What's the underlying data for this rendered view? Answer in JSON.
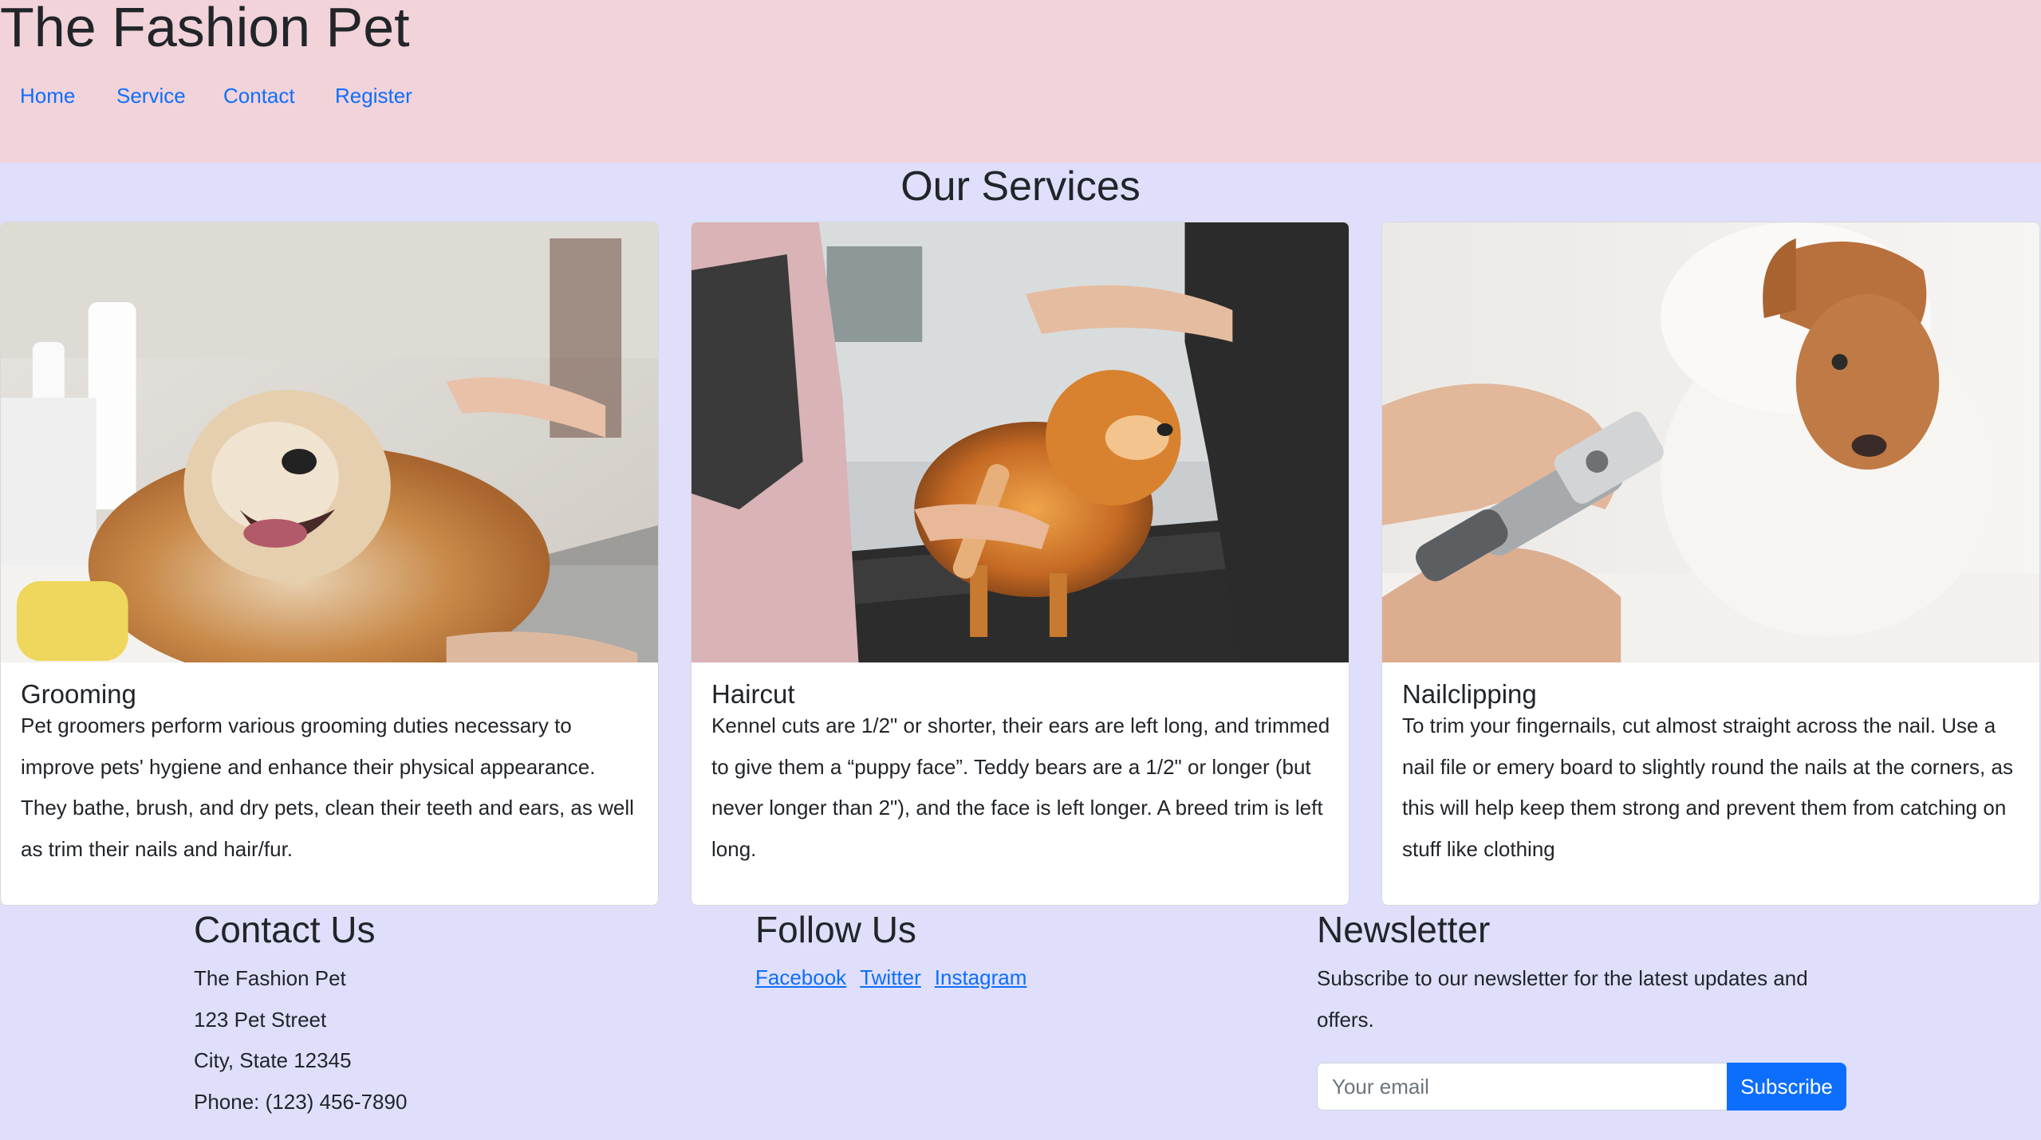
{
  "header": {
    "title": "The Fashion Pet",
    "nav": [
      {
        "label": "Home"
      },
      {
        "label": "Service"
      },
      {
        "label": "Contact"
      },
      {
        "label": "Register"
      }
    ]
  },
  "services": {
    "title": "Our Services",
    "cards": [
      {
        "title": "Grooming",
        "image": "dog-being-bathed-photo",
        "text": "Pet groomers perform various grooming duties necessary to improve pets' hygiene and enhance their physical appearance. They bathe, brush, and dry pets, clean their teeth and ears, as well as trim their nails and hair/fur."
      },
      {
        "title": "Haircut",
        "image": "pomeranian-haircut-photo",
        "text": "Kennel cuts are 1/2\" or shorter, their ears are left long, and trimmed to give them a “puppy face”. Teddy bears are a 1/2\" or longer (but never longer than 2\"), and the face is left longer. A breed trim is left long."
      },
      {
        "title": "Nailclipping",
        "image": "puppy-nail-clipping-photo",
        "text": "To trim your fingernails, cut almost straight across the nail. Use a nail file or emery board to slightly round the nails at the corners, as this will help keep them strong and prevent them from catching on stuff like clothing"
      }
    ]
  },
  "footer": {
    "contact": {
      "title": "Contact Us",
      "lines": [
        "The Fashion Pet",
        "123 Pet Street",
        "City, State 12345",
        "Phone: (123) 456-7890"
      ]
    },
    "follow": {
      "title": "Follow Us",
      "links": [
        "Facebook",
        "Twitter",
        "Instagram"
      ]
    },
    "newsletter": {
      "title": "Newsletter",
      "text": "Subscribe to our newsletter for the latest updates and offers.",
      "placeholder": "Your email",
      "button": "Subscribe"
    }
  },
  "colors": {
    "header_bg": "#f1d3d9",
    "page_bg": "#dfdffc",
    "link": "#0d6efd",
    "button": "#0d6efd"
  }
}
